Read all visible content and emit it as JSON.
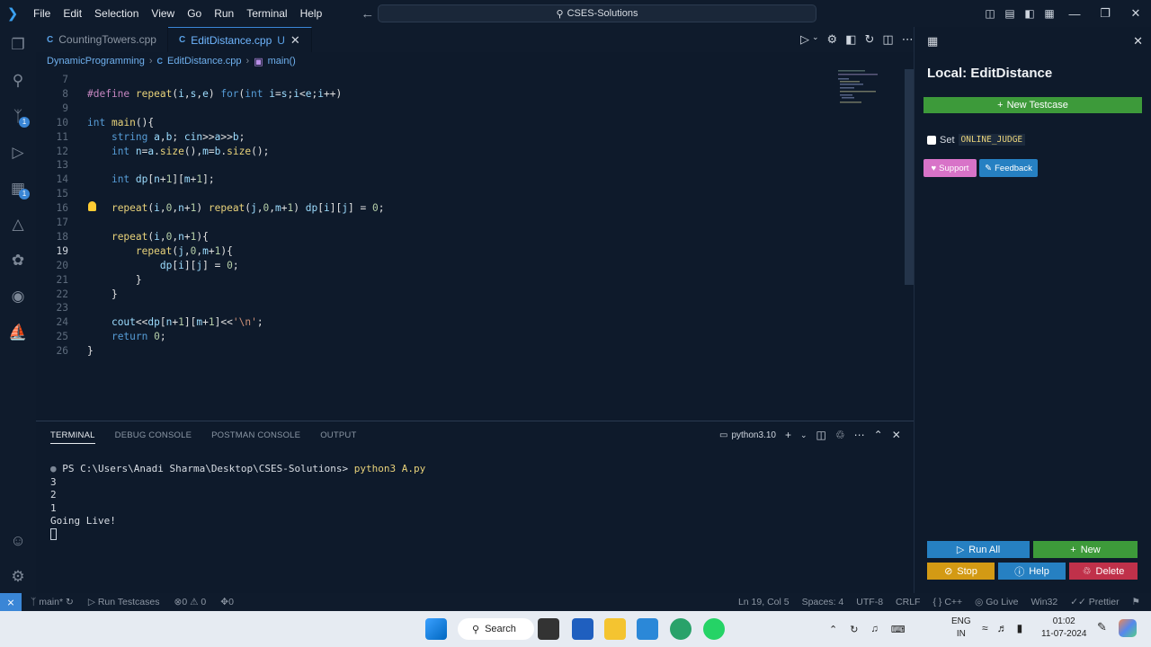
{
  "titlebar": {
    "menu": [
      "File",
      "Edit",
      "Selection",
      "View",
      "Go",
      "Run",
      "Terminal",
      "Help"
    ],
    "search": "CSES-Solutions"
  },
  "tabs": [
    {
      "name": "CountingTowers.cpp",
      "active": false,
      "modified": ""
    },
    {
      "name": "EditDistance.cpp",
      "active": true,
      "modified": "U"
    }
  ],
  "breadcrumb": {
    "folder": "DynamicProgramming",
    "file": "EditDistance.cpp",
    "symbol": "main()"
  },
  "editor": {
    "current_line": 19,
    "lines": [
      {
        "n": 7,
        "t": ""
      },
      {
        "n": 8,
        "t": "#define repeat(i,s,e) for(int i=s;i<e;i++)"
      },
      {
        "n": 9,
        "t": ""
      },
      {
        "n": 10,
        "t": "int main(){"
      },
      {
        "n": 11,
        "t": "    string a,b; cin>>a>>b;"
      },
      {
        "n": 12,
        "t": "    int n=a.size(),m=b.size();"
      },
      {
        "n": 13,
        "t": ""
      },
      {
        "n": 14,
        "t": "    int dp[n+1][m+1];"
      },
      {
        "n": 15,
        "t": ""
      },
      {
        "n": 16,
        "t": "    repeat(i,0,n+1) repeat(j,0,m+1) dp[i][j] = 0;"
      },
      {
        "n": 17,
        "t": ""
      },
      {
        "n": 18,
        "t": "    repeat(i,0,n+1){"
      },
      {
        "n": 19,
        "t": "        repeat(j,0,m+1){"
      },
      {
        "n": 20,
        "t": "            dp[i][j] = 0;"
      },
      {
        "n": 21,
        "t": "        }"
      },
      {
        "n": 22,
        "t": "    }"
      },
      {
        "n": 23,
        "t": ""
      },
      {
        "n": 24,
        "t": "    cout<<dp[n+1][m+1]<<'\\n';"
      },
      {
        "n": 25,
        "t": "    return 0;"
      },
      {
        "n": 26,
        "t": "}"
      }
    ]
  },
  "panel": {
    "tabs": [
      "TERMINAL",
      "DEBUG CONSOLE",
      "POSTMAN CONSOLE",
      "OUTPUT"
    ],
    "shell": "python3.10",
    "terminal": {
      "prompt": "PS C:\\Users\\Anadi Sharma\\Desktop\\CSES-Solutions>",
      "command": "python3 A.py",
      "output": [
        "3",
        "2",
        "1",
        "Going Live!"
      ]
    }
  },
  "side": {
    "title": "Local: EditDistance",
    "new_testcase": "New Testcase",
    "set_label": "Set",
    "online_judge": "ONLINE_JUDGE",
    "support": "Support",
    "feedback": "Feedback",
    "run_all": "Run All",
    "new": "New",
    "stop": "Stop",
    "help": "Help",
    "delete": "Delete"
  },
  "statusbar": {
    "branch": "main*",
    "run_testcases": "Run Testcases",
    "problems": "0 ⚠ 0",
    "ports": "0",
    "position": "Ln 19, Col 5",
    "spaces": "Spaces: 4",
    "encoding": "UTF-8",
    "eol": "CRLF",
    "language": "C++",
    "golive": "Go Live",
    "platform": "Win32",
    "prettier": "Prettier"
  },
  "taskbar": {
    "search": "Search",
    "lang1": "ENG",
    "lang2": "IN",
    "time": "01:02",
    "date": "11-07-2024"
  },
  "colors": {
    "accent": "#3a86d6",
    "green": "#3d9a3a",
    "stop": "#d39a14",
    "delete": "#c0314a"
  }
}
